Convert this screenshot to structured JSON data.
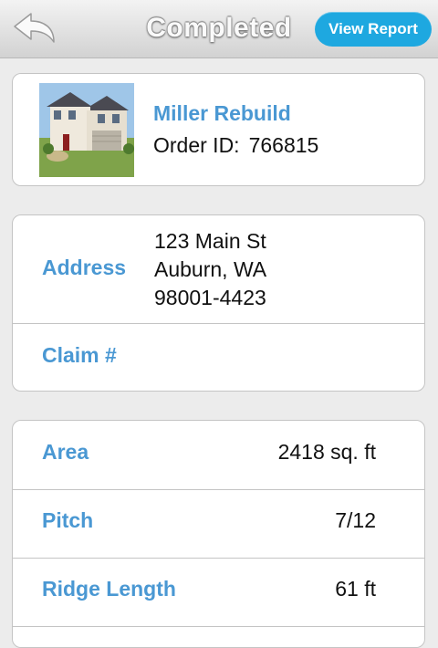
{
  "navbar": {
    "title": "Completed",
    "view_report_label": "View Report",
    "back_icon": "back-arrow-icon"
  },
  "order": {
    "project_name": "Miller Rebuild",
    "order_id_label": "Order ID:",
    "order_id": "766815",
    "thumbnail": "house-photo"
  },
  "address_card": {
    "address_label": "Address",
    "address_lines": [
      "123 Main St",
      "Auburn, WA",
      "98001-4423"
    ],
    "claim_label": "Claim #",
    "claim_value": ""
  },
  "metrics": [
    {
      "label": "Area",
      "value": "2418 sq. ft"
    },
    {
      "label": "Pitch",
      "value": "7/12"
    },
    {
      "label": "Ridge Length",
      "value": "61 ft"
    }
  ],
  "colors": {
    "accent": "#4a98d3",
    "button": "#1ea8e0"
  }
}
